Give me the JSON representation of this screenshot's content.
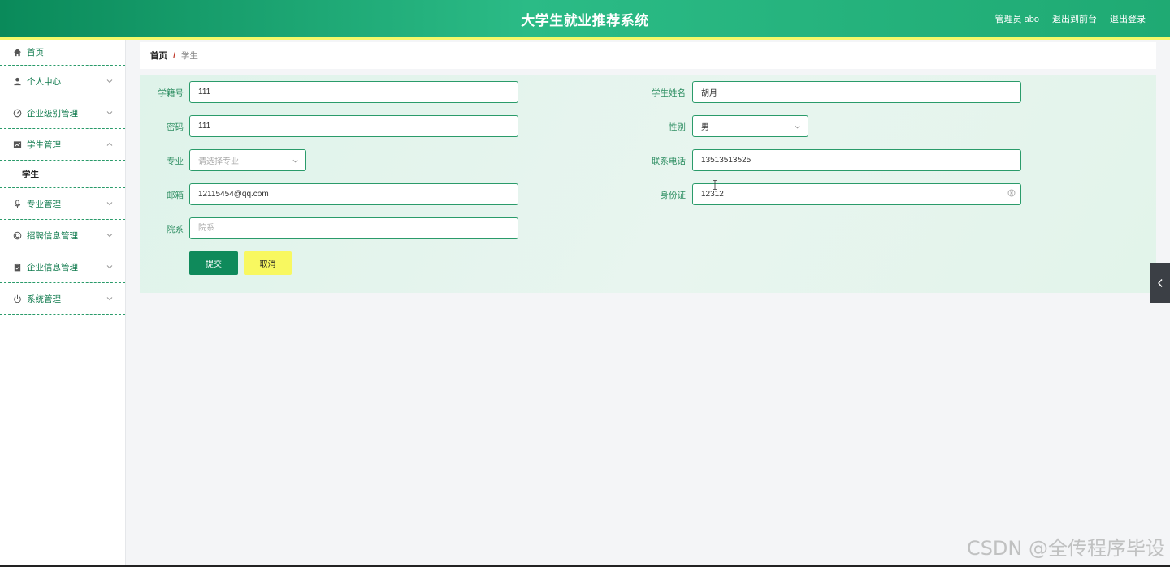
{
  "header": {
    "title": "大学生就业推荐系统",
    "user": "管理员 abo",
    "front_link": "退出到前台",
    "logout": "退出登录"
  },
  "sidebar": {
    "items": [
      {
        "label": "首页",
        "icon": "home-icon"
      },
      {
        "label": "个人中心",
        "icon": "user-icon"
      },
      {
        "label": "企业级别管理",
        "icon": "gauge-icon"
      },
      {
        "label": "学生管理",
        "icon": "chart-icon",
        "expanded": true,
        "children": [
          "学生"
        ]
      },
      {
        "label": "专业管理",
        "icon": "microphone-icon"
      },
      {
        "label": "招聘信息管理",
        "icon": "target-icon"
      },
      {
        "label": "企业信息管理",
        "icon": "clipboard-icon"
      },
      {
        "label": "系统管理",
        "icon": "power-icon"
      }
    ]
  },
  "breadcrumb": {
    "home": "首页",
    "separator": "/",
    "current": "学生"
  },
  "form": {
    "student_no": {
      "label": "学籍号",
      "value": "111"
    },
    "student_name": {
      "label": "学生姓名",
      "value": "胡月"
    },
    "password": {
      "label": "密码",
      "value": "111"
    },
    "gender": {
      "label": "性别",
      "value": "男"
    },
    "major": {
      "label": "专业",
      "placeholder": "请选择专业"
    },
    "phone": {
      "label": "联系电话",
      "value": "13513513525"
    },
    "email": {
      "label": "邮箱",
      "value": "12115454@qq.com"
    },
    "id_card": {
      "label": "身份证",
      "value": "12312"
    },
    "department": {
      "label": "院系",
      "placeholder": "院系",
      "value": ""
    },
    "submit_label": "提交",
    "cancel_label": "取消"
  },
  "colors": {
    "primary": "#0f8a5b",
    "accent_yellow": "#f8f860",
    "label_green": "#2f8f63"
  },
  "watermark": "CSDN @全传程序毕设"
}
